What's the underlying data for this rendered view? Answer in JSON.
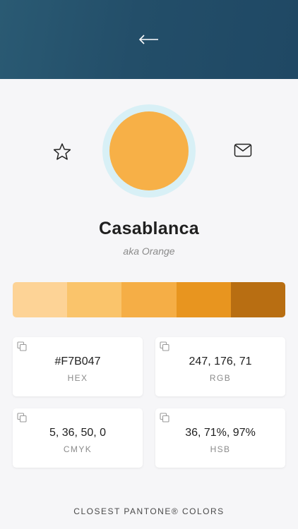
{
  "header": {
    "back_icon": "back-arrow-icon"
  },
  "actions": {
    "favorite_icon": "star-icon",
    "share_icon": "mail-icon"
  },
  "color": {
    "name": "Casablanca",
    "aka": "aka Orange",
    "hex_color": "#F7B047",
    "ring_color": "#D8F0F6"
  },
  "shades": [
    "#FDD396",
    "#FAC46B",
    "#F5AE46",
    "#E8951F",
    "#B86E12"
  ],
  "cards": [
    {
      "value": "#F7B047",
      "label": "HEX"
    },
    {
      "value": "247, 176, 71",
      "label": "RGB"
    },
    {
      "value": "5, 36, 50, 0",
      "label": "CMYK"
    },
    {
      "value": "36, 71%, 97%",
      "label": "HSB"
    }
  ],
  "section_title": "CLOSEST PANTONE® COLORS"
}
